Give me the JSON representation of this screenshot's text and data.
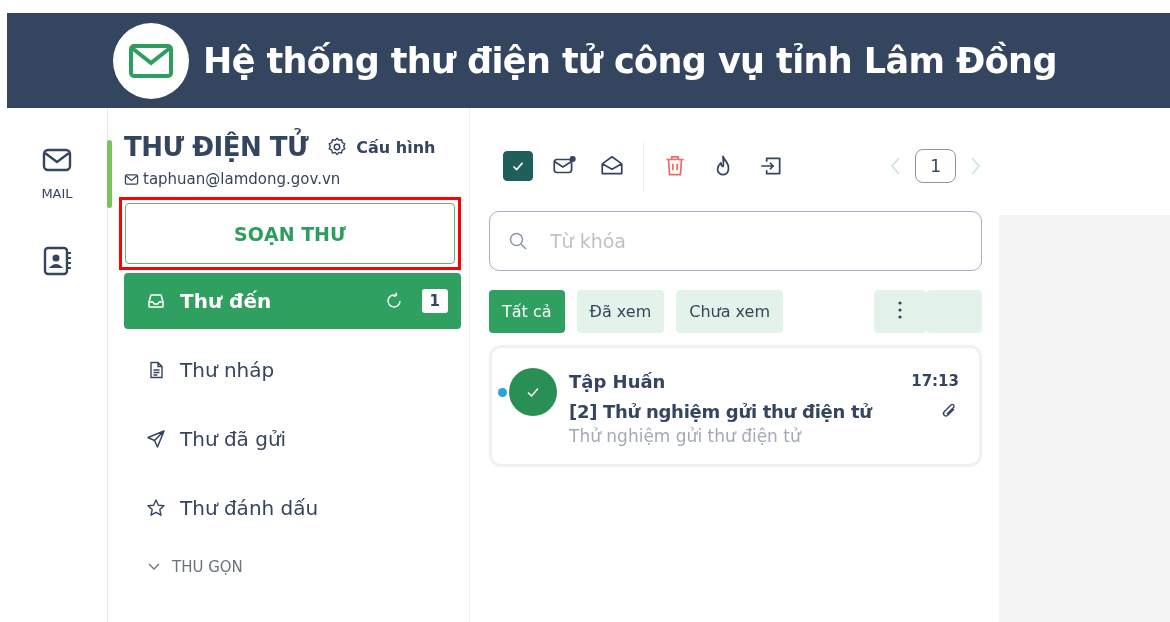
{
  "header": {
    "title": "Hệ thống thư điện tử công vụ tỉnh Lâm Đồng"
  },
  "rail": {
    "items": [
      {
        "kind": "mail",
        "label": "MAIL",
        "selected": true
      },
      {
        "kind": "contacts",
        "selected": false
      }
    ]
  },
  "sidebar": {
    "title": "THƯ ĐIỆN TỬ",
    "settings_label": "Cấu hình",
    "account": "taphuan@lamdong.gov.vn",
    "compose": "SOẠN THƯ",
    "compose_highlighted": true,
    "folders": [
      {
        "kind": "inbox",
        "label": "Thư đến",
        "selected": true,
        "count": "1"
      },
      {
        "kind": "drafts",
        "label": "Thư nháp",
        "selected": false
      },
      {
        "kind": "sent",
        "label": "Thư đã gửi",
        "selected": false
      },
      {
        "kind": "starred",
        "label": "Thư đánh dấu",
        "selected": false
      }
    ],
    "collapse": "THU GỌN"
  },
  "toolbar": {
    "select_all_checked": true,
    "page": "1"
  },
  "search": {
    "placeholder": "Từ khóa"
  },
  "filters": [
    {
      "label": "Tất cả",
      "selected": true
    },
    {
      "label": "Đã xem",
      "selected": false
    },
    {
      "label": "Chưa xem",
      "selected": false
    }
  ],
  "messages": [
    {
      "sender": "Tập Huấn",
      "subject": "[2] Thử nghiệm gửi thư điện tử",
      "preview": "Thử nghiệm gửi thư điện tử",
      "time": "17:13",
      "unread": true,
      "checked": true,
      "attachment": true
    }
  ]
}
